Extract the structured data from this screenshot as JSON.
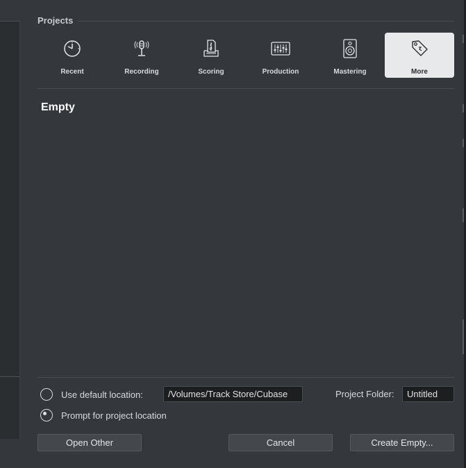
{
  "projects": {
    "title": "Projects",
    "tabs": [
      {
        "label": "Recent",
        "icon": "clock-icon"
      },
      {
        "label": "Recording",
        "icon": "microphone-icon"
      },
      {
        "label": "Scoring",
        "icon": "sheet-music-icon"
      },
      {
        "label": "Production",
        "icon": "mixer-icon"
      },
      {
        "label": "Mastering",
        "icon": "speaker-icon"
      },
      {
        "label": "More",
        "icon": "tag-icon"
      }
    ],
    "active_tab": "More"
  },
  "content": {
    "title": "Empty"
  },
  "location": {
    "default_label": "Use default location:",
    "default_path": "/Volumes/Track Store/Cubase",
    "prompt_label": "Prompt for project location",
    "selected": "prompt",
    "folder_label": "Project Folder:",
    "folder_value": "Untitled"
  },
  "buttons": {
    "open_other": "Open Other",
    "cancel": "Cancel",
    "create_empty": "Create Empty..."
  }
}
